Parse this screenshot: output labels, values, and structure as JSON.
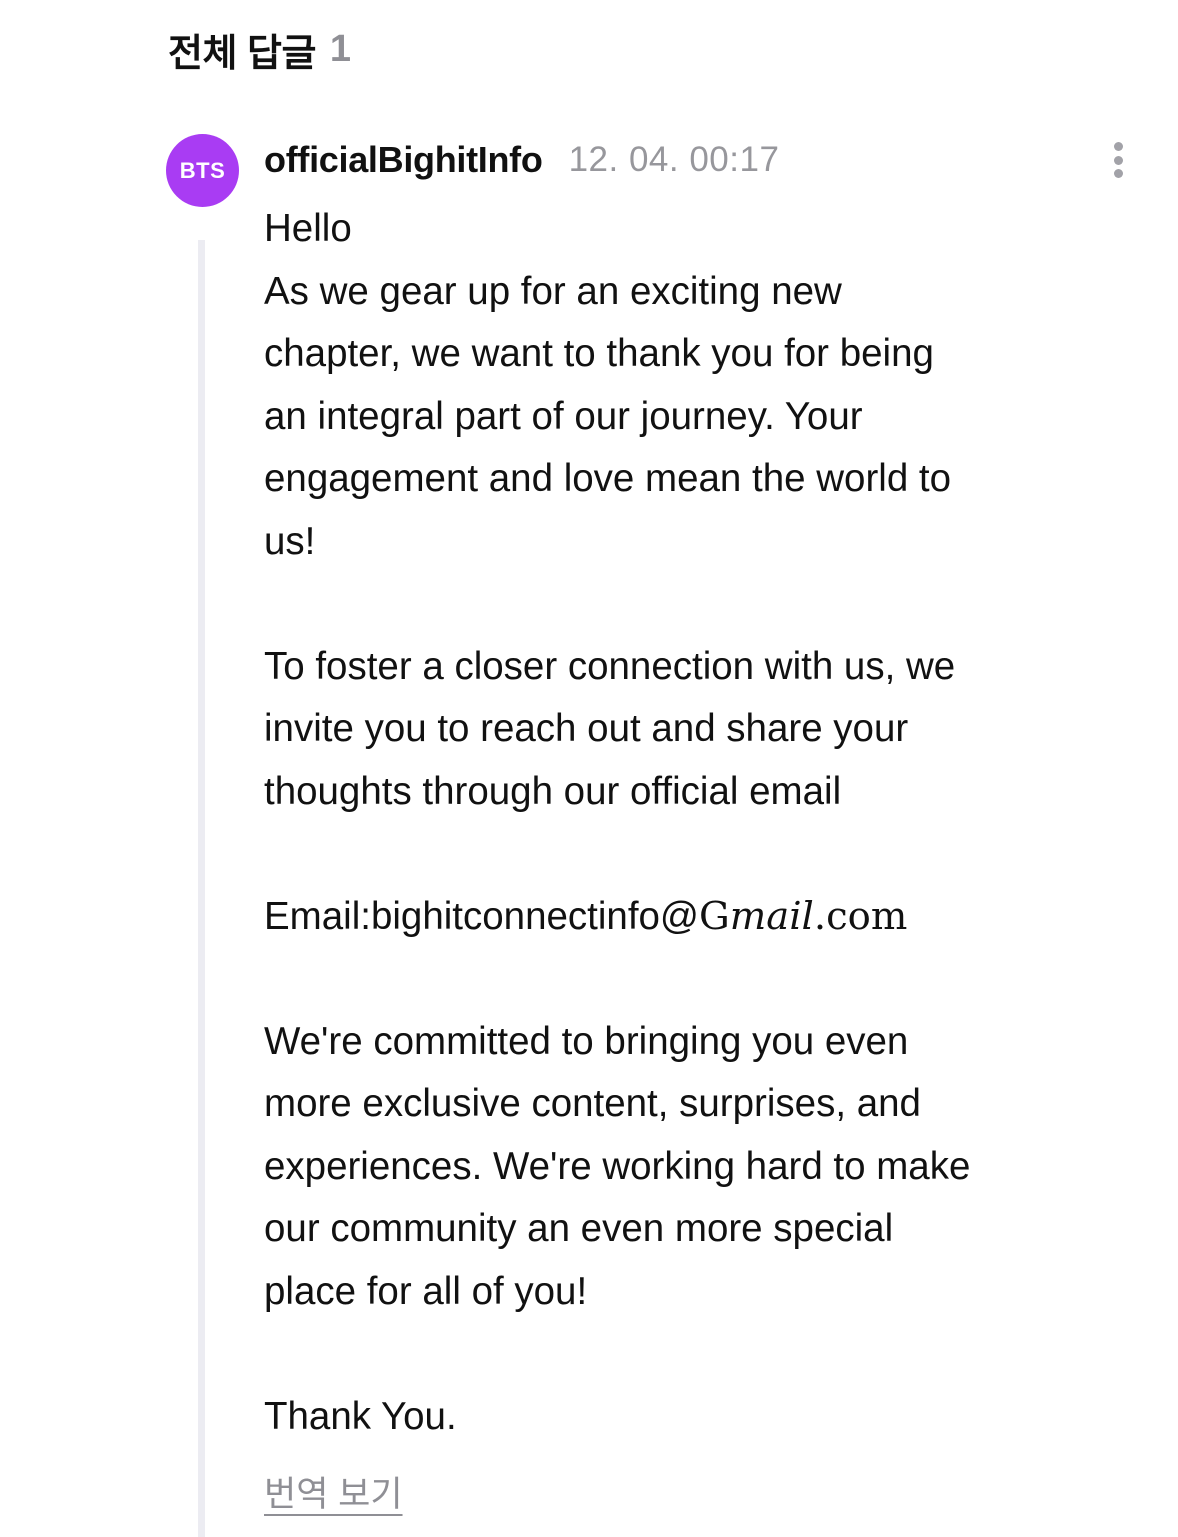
{
  "header": {
    "title": "전체 답글",
    "count": "1"
  },
  "comment": {
    "avatar_text": "BTS",
    "avatar_color": "#a93cf3",
    "author": "officialBighitInfo",
    "timestamp": "12. 04. 00:17",
    "more_icon": "vertical-ellipsis-icon",
    "body": {
      "p1": [
        "Hello",
        "As we gear up for an exciting new",
        "chapter, we want to thank you for being",
        "an integral part of our journey. Your",
        "engagement and love mean the world to",
        "us!"
      ],
      "p2": [
        "To foster a closer connection with us, we",
        "invite you to reach out and share your",
        "thoughts through our official email"
      ],
      "email_prefix": "Email:bighitconnectinfo@",
      "email_g": "G",
      "email_mail": "mail",
      "email_dot": ".",
      "email_com": "com",
      "p4": [
        "We're committed to bringing you even",
        "more exclusive content, surprises, and",
        "experiences. We're working hard to make",
        "our community an even more special",
        "place for all of you!"
      ],
      "closing": "Thank You."
    },
    "translate_label": "번역 보기"
  }
}
